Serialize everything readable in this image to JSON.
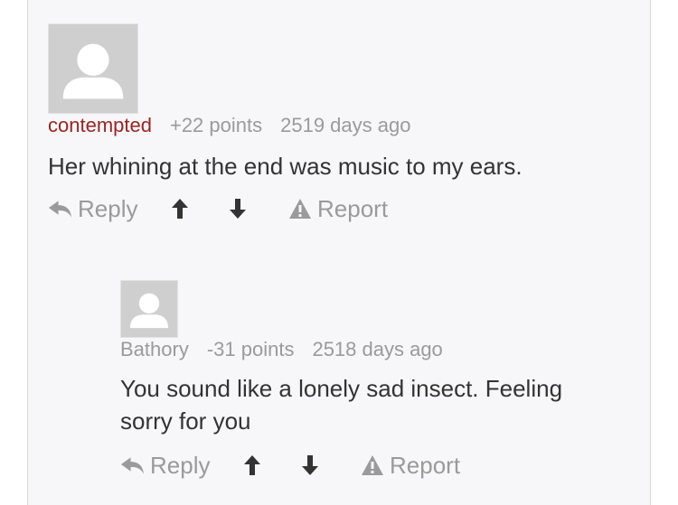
{
  "comments": [
    {
      "username": "contempted",
      "points": "+22 points",
      "age": "2519 days ago",
      "text": "Her whining at the end was music to my ears.",
      "actions": {
        "reply": "Reply",
        "report": "Report"
      },
      "icons": [
        "avatar-placeholder-icon",
        "reply-arrow-icon",
        "upvote-arrow-icon",
        "downvote-arrow-icon",
        "warning-triangle-icon"
      ]
    },
    {
      "username": "Bathory",
      "points": "-31 points",
      "age": "2518 days ago",
      "text": "You sound like a lonely sad insect. Feeling sorry for you",
      "actions": {
        "reply": "Reply",
        "report": "Report"
      },
      "icons": [
        "avatar-placeholder-icon",
        "reply-arrow-icon",
        "upvote-arrow-icon",
        "downvote-arrow-icon",
        "warning-triangle-icon"
      ]
    }
  ],
  "colors": {
    "panel_bg": "#f7f7f9",
    "username_highlight": "#9b2420",
    "meta_text": "#9a9a9a",
    "body_text": "#333333",
    "vote_arrows": "#333333"
  }
}
